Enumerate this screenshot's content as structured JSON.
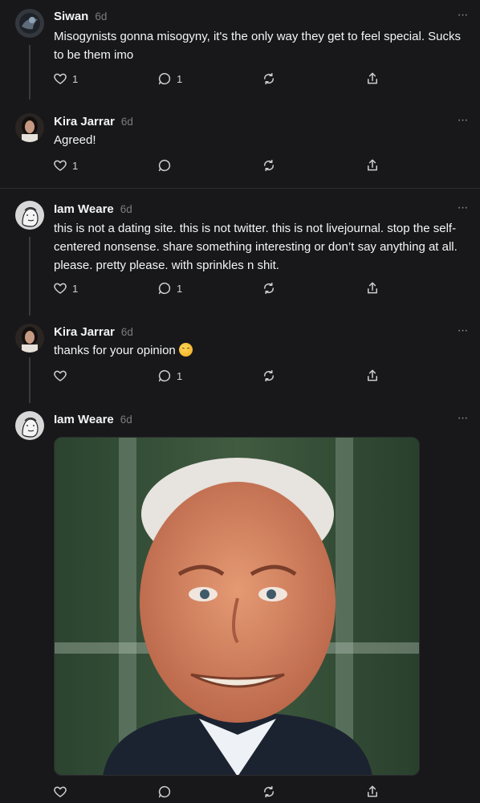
{
  "posts": [
    {
      "author": "Siwan",
      "time": "6d",
      "text": "Misogynists gonna misogyny, it's the only way they get to feel special. Sucks to be them imo",
      "likes": "1",
      "replies": "1",
      "avatar_icon": "dark-avatar-icon"
    },
    {
      "author": "Kira Jarrar",
      "time": "6d",
      "text": "Agreed!",
      "likes": "1",
      "replies": "",
      "avatar_icon": "woman-avatar-icon"
    },
    {
      "author": "Iam Weare",
      "time": "6d",
      "text": "this is not a dating site. this is not twitter. this is not livejournal. stop the self-centered nonsense. share something interesting or don’t say anything at all. please. pretty please. with sprinkles n shit.",
      "likes": "1",
      "replies": "1",
      "avatar_icon": "sketch-face-avatar-icon"
    },
    {
      "author": "Kira Jarrar",
      "time": "6d",
      "text": "thanks for your opinion",
      "likes": "",
      "replies": "1",
      "avatar_icon": "woman-avatar-icon",
      "emoji": "hugging-face-emoji"
    },
    {
      "author": "Iam Weare",
      "time": "6d",
      "text": "",
      "likes": "",
      "replies": "",
      "avatar_icon": "sketch-face-avatar-icon",
      "media": "photo-of-grimacing-man-in-suit"
    }
  ],
  "icons": {
    "like": "heart-icon",
    "reply": "comment-icon",
    "repost": "repost-icon",
    "share": "share-icon",
    "more": "more-options-icon"
  },
  "colors": {
    "background": "#18181a",
    "text": "#f3f5f7",
    "muted": "#7b7b7f"
  }
}
